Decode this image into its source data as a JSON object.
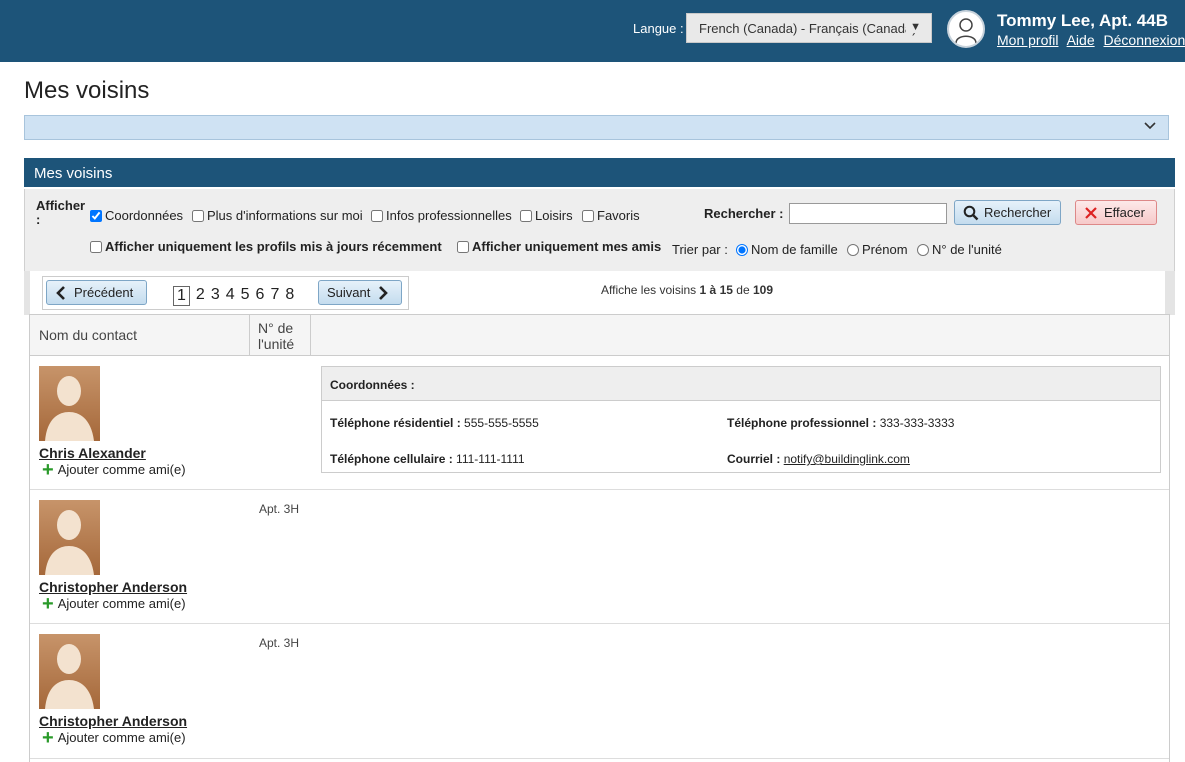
{
  "header": {
    "lang_label": "Langue :",
    "lang_value": "French (Canada) - Français (Canada)",
    "user_name": "Tommy Lee, Apt. 44B",
    "links": [
      "Mon profil",
      "Aide",
      "Déconnexion"
    ]
  },
  "page": {
    "title": "Mes voisins"
  },
  "panel": {
    "title": "Mes voisins",
    "show_label": "Afficher :",
    "show_options": [
      {
        "label": "Coordonnées",
        "checked": true
      },
      {
        "label": "Plus d'informations sur moi",
        "checked": false
      },
      {
        "label": "Infos professionnelles",
        "checked": false
      },
      {
        "label": "Loisirs",
        "checked": false
      },
      {
        "label": "Favoris",
        "checked": false
      }
    ],
    "recent_only": "Afficher uniquement les profils mis à jours récemment",
    "friends_only": "Afficher uniquement mes amis",
    "search_label": "Rechercher :",
    "search_button": "Rechercher",
    "clear_button": "Effacer",
    "sort_label": "Trier par :",
    "sort_options": [
      "Nom de famille",
      "Prénom",
      "N° de l'unité"
    ],
    "sort_selected": "Nom de famille"
  },
  "pager": {
    "prev": "Précédent",
    "next": "Suivant",
    "pages": [
      "1",
      "2",
      "3",
      "4",
      "5",
      "6",
      "7",
      "8"
    ],
    "current": "1",
    "count_prefix": "Affiche les voisins",
    "from": "1",
    "to_word": "à",
    "to": "15",
    "of_word": "de",
    "total": "109"
  },
  "table": {
    "col_contact": "Nom du contact",
    "col_unit": "N° de l'unité"
  },
  "neighbors": [
    {
      "name": "Chris Alexander",
      "unit": "",
      "add_friend": "Ajouter comme ami(e)",
      "contact": {
        "heading": "Coordonnées :",
        "home_label": "Téléphone résidentiel :",
        "home": "555-555-5555",
        "work_label": "Téléphone professionnel :",
        "work": "333-333-3333",
        "cell_label": "Téléphone cellulaire :",
        "cell": "111-111-1111",
        "email_label": "Courriel :",
        "email": "notify@buildinglink.com"
      }
    },
    {
      "name": "Christopher Anderson",
      "unit": "Apt. 3H",
      "add_friend": "Ajouter comme ami(e)"
    },
    {
      "name": "Christopher Anderson",
      "unit": "Apt. 3H",
      "add_friend": "Ajouter comme ami(e)"
    }
  ]
}
